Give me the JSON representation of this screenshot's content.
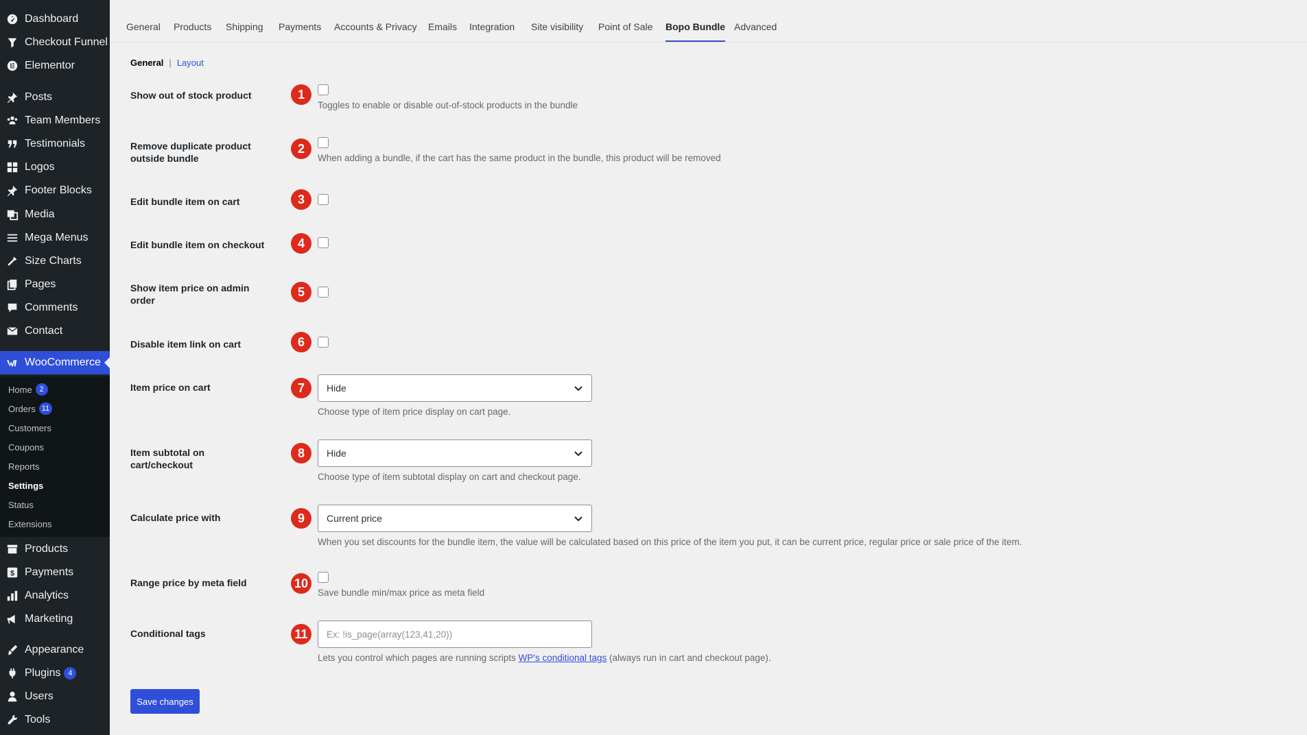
{
  "sidebar": {
    "items": [
      {
        "label": "Dashboard",
        "icon": "dashboard-icon"
      },
      {
        "label": "Checkout Funnel",
        "icon": "funnel-icon"
      },
      {
        "label": "Elementor",
        "icon": "elementor-icon"
      },
      {
        "label": "Posts",
        "icon": "pin-icon"
      },
      {
        "label": "Team Members",
        "icon": "users-group-icon"
      },
      {
        "label": "Testimonials",
        "icon": "quote-icon"
      },
      {
        "label": "Logos",
        "icon": "grid-icon"
      },
      {
        "label": "Footer Blocks",
        "icon": "pin-icon"
      },
      {
        "label": "Media",
        "icon": "media-icon"
      },
      {
        "label": "Mega Menus",
        "icon": "menu-icon"
      },
      {
        "label": "Size Charts",
        "icon": "tools-icon"
      },
      {
        "label": "Pages",
        "icon": "pages-icon"
      },
      {
        "label": "Comments",
        "icon": "comment-icon"
      },
      {
        "label": "Contact",
        "icon": "mail-icon"
      },
      {
        "label": "WooCommerce",
        "icon": "woo-icon"
      },
      {
        "label": "Products",
        "icon": "archive-icon"
      },
      {
        "label": "Payments",
        "icon": "dollar-icon"
      },
      {
        "label": "Analytics",
        "icon": "chart-icon"
      },
      {
        "label": "Marketing",
        "icon": "megaphone-icon"
      },
      {
        "label": "Appearance",
        "icon": "brush-icon"
      },
      {
        "label": "Plugins",
        "icon": "plug-icon",
        "badge": "4"
      },
      {
        "label": "Users",
        "icon": "user-icon"
      },
      {
        "label": "Tools",
        "icon": "wrench-icon"
      }
    ],
    "submenu": [
      {
        "label": "Home",
        "badge": "2"
      },
      {
        "label": "Orders",
        "badge": "11"
      },
      {
        "label": "Customers"
      },
      {
        "label": "Coupons"
      },
      {
        "label": "Reports"
      },
      {
        "label": "Settings"
      },
      {
        "label": "Status"
      },
      {
        "label": "Extensions"
      }
    ]
  },
  "tabs": [
    "General",
    "Products",
    "Shipping",
    "Payments",
    "Accounts & Privacy",
    "Emails",
    "Integration",
    "Site visibility",
    "Point of Sale",
    "Bopo Bundle",
    "Advanced"
  ],
  "active_tab": "Bopo Bundle",
  "subsub": {
    "current": "General",
    "separator": "|",
    "link": "Layout"
  },
  "rows": [
    {
      "num": "1",
      "label": "Show out of stock product",
      "type": "checkbox",
      "checked": false,
      "desc": "Toggles to enable or disable out-of-stock products in the bundle"
    },
    {
      "num": "2",
      "label": "Remove duplicate product outside bundle",
      "type": "checkbox",
      "checked": false,
      "desc": "When adding a bundle, if the cart has the same product in the bundle, this product will be removed"
    },
    {
      "num": "3",
      "label": "Edit bundle item on cart",
      "type": "checkbox",
      "checked": false
    },
    {
      "num": "4",
      "label": "Edit bundle item on checkout",
      "type": "checkbox",
      "checked": false
    },
    {
      "num": "5",
      "label": "Show item price on admin order",
      "type": "checkbox",
      "checked": false
    },
    {
      "num": "6",
      "label": "Disable item link on cart",
      "type": "checkbox",
      "checked": false
    },
    {
      "num": "7",
      "label": "Item price on cart",
      "type": "select",
      "value": "Hide",
      "desc": "Choose type of item price display on cart page."
    },
    {
      "num": "8",
      "label": "Item subtotal on cart/checkout",
      "type": "select",
      "value": "Hide",
      "desc": "Choose type of item subtotal display on cart and checkout page."
    },
    {
      "num": "9",
      "label": "Calculate price with",
      "type": "select",
      "value": "Current price",
      "desc": "When you set discounts for the bundle item, the value will be calculated based on this price of the item you put, it can be current price, regular price or sale price of the item."
    },
    {
      "num": "10",
      "label": "Range price by meta field",
      "type": "checkbox",
      "checked": false,
      "desc": "Save bundle min/max price as meta field"
    },
    {
      "num": "11",
      "label": "Conditional tags",
      "type": "text",
      "placeholder": "Ex: !is_page(array(123,41,20))",
      "desc_before": "Lets you control which pages are running scripts ",
      "desc_link": "WP's conditional tags",
      "desc_after": " (always run in cart and checkout page)."
    }
  ],
  "save_label": "Save changes",
  "colors": {
    "accent": "#2f4fd9",
    "marker": "#dd2a1b",
    "sidebar_bg": "#1d2327"
  }
}
